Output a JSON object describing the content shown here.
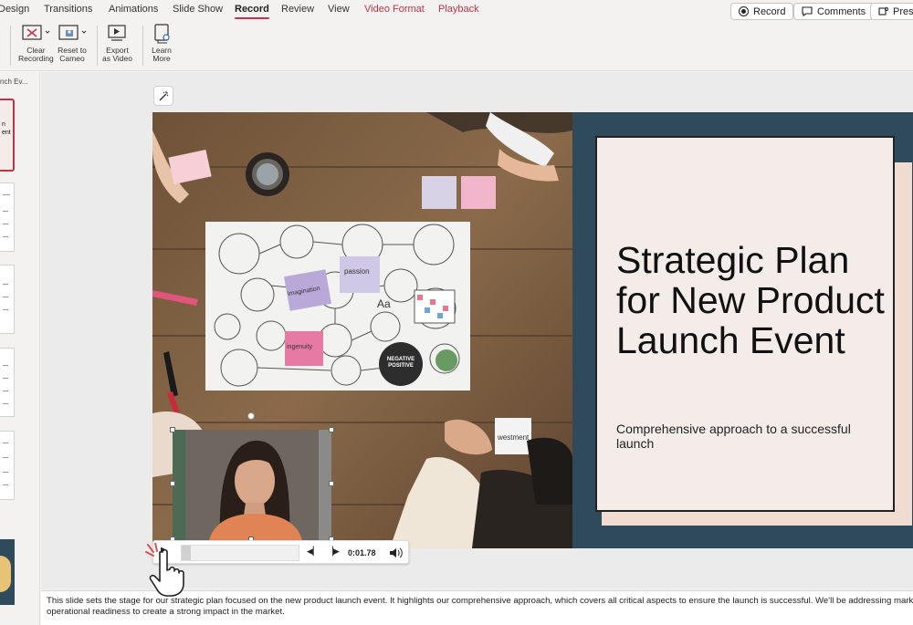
{
  "tabs": [
    {
      "label": "Design"
    },
    {
      "label": "Transitions"
    },
    {
      "label": "Animations"
    },
    {
      "label": "Slide Show"
    },
    {
      "label": "Record"
    },
    {
      "label": "Review"
    },
    {
      "label": "View"
    },
    {
      "label": "Video Format"
    },
    {
      "label": "Playback"
    }
  ],
  "top_buttons": {
    "record": "Record",
    "comments": "Comments",
    "present": "Prese"
  },
  "ribbon": {
    "clear_recording": "Clear\nRecording",
    "reset_to_cameo": "Reset to\nCameo",
    "export_as_video": "Export\nas Video",
    "learn_more": "Learn\nMore"
  },
  "thumbnails": {
    "section_label": "nch Ev...",
    "selected_thumb_text": "n\nent"
  },
  "slide": {
    "title": "Strategic Plan for New Product Launch Event",
    "subtitle": "Comprehensive approach to a successful launch"
  },
  "photo_notes": {
    "note1": "passion",
    "note2": "ingenuity",
    "note3": "imagination",
    "note4": "NEGATIVE POSITIVE",
    "note5": "Aa",
    "note6": "westment"
  },
  "playback": {
    "time": "0:01.78",
    "progress": 0.08
  },
  "notes": {
    "text": "This slide sets the stage for our strategic plan focused on the new product launch event. It highlights our comprehensive approach, which covers all critical aspects to ensure the launch is successful. We'll be addressing market operational readiness to create a strong impact in the market."
  },
  "colors": {
    "accent": "#c4314b",
    "slide_bg": "#2f4a5a",
    "card_bg": "#f4ece8",
    "card_shadow": "#f1dcd2"
  }
}
